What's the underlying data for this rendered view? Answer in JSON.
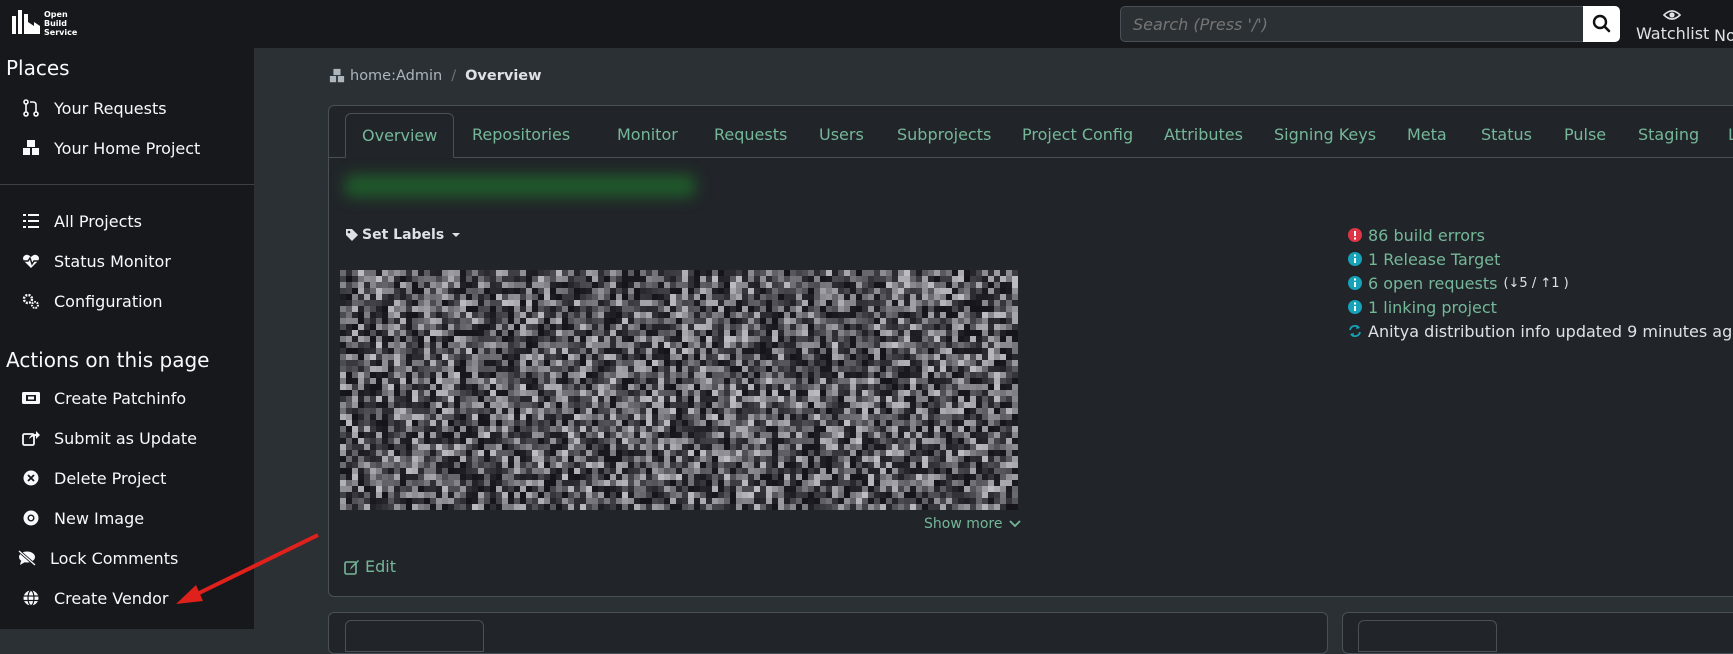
{
  "app": {
    "logo_lines": [
      "Open",
      "Build",
      "Service"
    ]
  },
  "search": {
    "placeholder": "Search (Press '/')"
  },
  "header": {
    "watchlist_label": "Watchlist",
    "notifications_label": "No"
  },
  "sidebar": {
    "places_heading": "Places",
    "places": [
      {
        "label": "Your Requests",
        "icon": "pull-request-icon"
      },
      {
        "label": "Your Home Project",
        "icon": "cubes-icon"
      }
    ],
    "nav": [
      {
        "label": "All Projects",
        "icon": "list-icon"
      },
      {
        "label": "Status Monitor",
        "icon": "heartbeat-icon"
      },
      {
        "label": "Configuration",
        "icon": "cogs-icon"
      }
    ],
    "actions_heading": "Actions on this page",
    "actions": [
      {
        "label": "Create Patchinfo",
        "icon": "ticket-icon"
      },
      {
        "label": "Submit as Update",
        "icon": "share-icon"
      },
      {
        "label": "Delete Project",
        "icon": "times-circle-icon"
      },
      {
        "label": "New Image",
        "icon": "compact-disc-icon"
      },
      {
        "label": "Lock Comments",
        "icon": "comment-slash-icon"
      },
      {
        "label": "Create Vendor",
        "icon": "globe-icon"
      }
    ]
  },
  "breadcrumb": {
    "project": "home:Admin",
    "separator": "/",
    "current": "Overview"
  },
  "tabs": [
    "Overview",
    "Repositories",
    "Monitor",
    "Requests",
    "Users",
    "Subprojects",
    "Project Config",
    "Attributes",
    "Signing Keys",
    "Meta",
    "Status",
    "Pulse",
    "Staging",
    "La"
  ],
  "active_tab": "Overview",
  "project": {
    "set_labels": "Set Labels",
    "show_more": "Show more",
    "edit": "Edit"
  },
  "stats": {
    "build_errors": "86 build errors",
    "release_target": "1 Release Target",
    "open_requests": "6 open requests",
    "requests_in": "5",
    "requests_out": "1",
    "linking": "1 linking project",
    "anitya": "Anitya distribution info updated 9 minutes ago"
  },
  "colors": {
    "link": "#75b798",
    "error": "#dc3545",
    "info": "#17a2b8",
    "annotation": "#e0201b"
  }
}
